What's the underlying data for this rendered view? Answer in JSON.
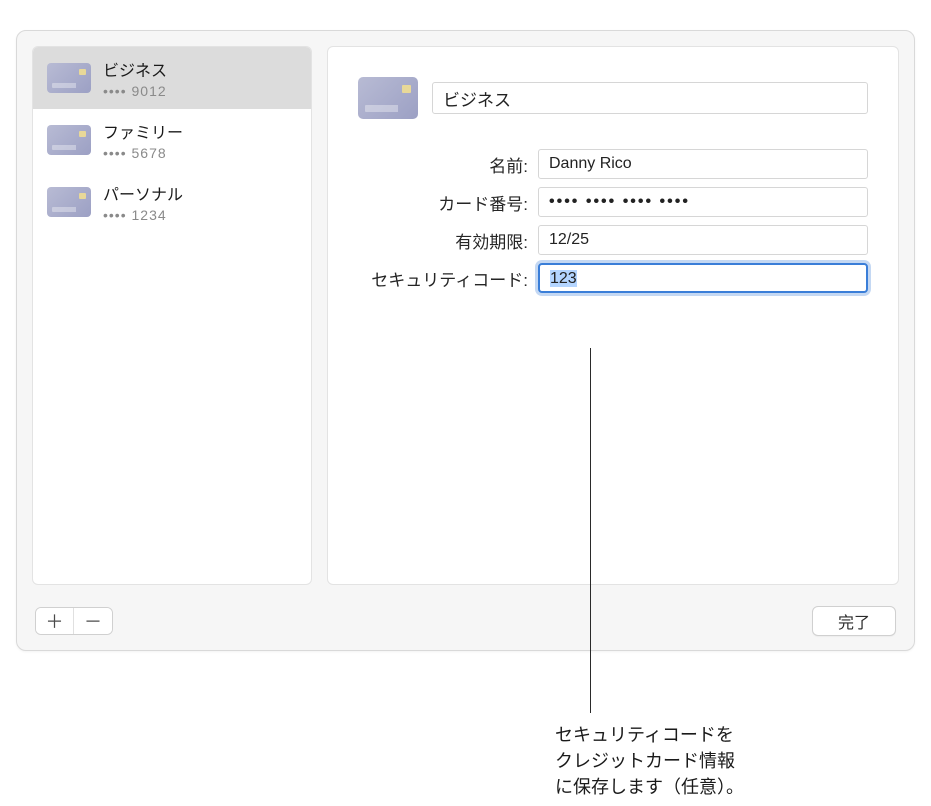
{
  "sidebar": {
    "items": [
      {
        "title": "ビジネス",
        "sub": "•••• 9012",
        "selected": true
      },
      {
        "title": "ファミリー",
        "sub": "•••• 5678",
        "selected": false
      },
      {
        "title": "パーソナル",
        "sub": "•••• 1234",
        "selected": false
      }
    ]
  },
  "detail": {
    "title": "ビジネス",
    "fields": {
      "name_label": "名前:",
      "name_value": "Danny Rico",
      "number_label": "カード番号:",
      "number_value": "•••• •••• •••• ••••",
      "expiry_label": "有効期限:",
      "expiry_value": "12/25",
      "cvc_label": "セキュリティコード:",
      "cvc_value": "123"
    }
  },
  "buttons": {
    "add": "＋",
    "remove": "－",
    "done": "完了"
  },
  "callout": "セキュリティコードを\nクレジットカード情報\nに保存します（任意）。"
}
